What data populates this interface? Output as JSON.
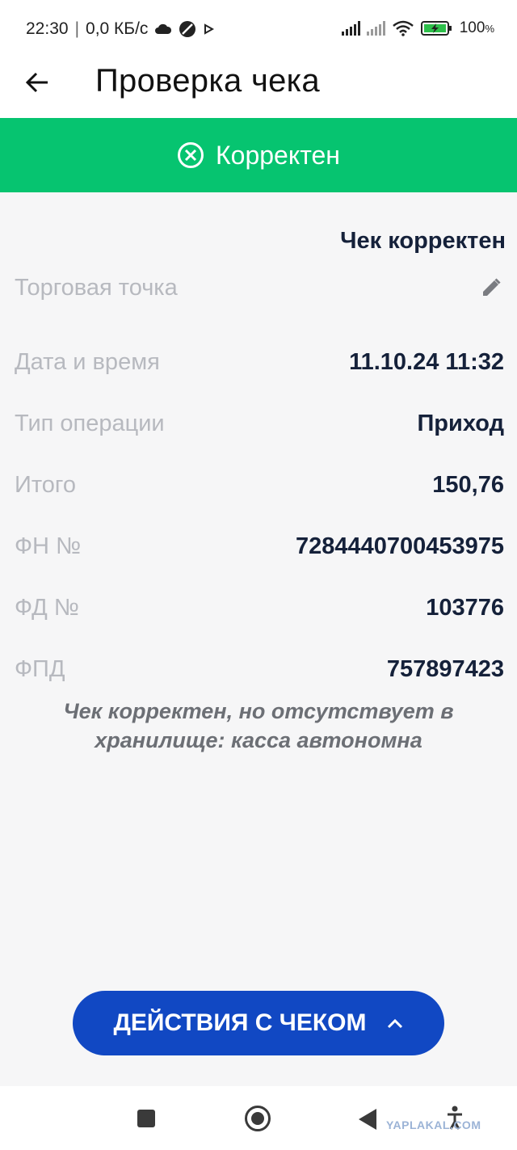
{
  "status_bar": {
    "time": "22:30",
    "separator": "|",
    "network_speed": "0,0 КБ/с",
    "battery": "100",
    "battery_unit": "%",
    "icons": [
      "cloud-icon",
      "no-disturb-icon",
      "play-icon",
      "signal-icon",
      "signal-icon",
      "wifi-icon",
      "battery-charging-icon"
    ],
    "battery_color": "#2dbf4a"
  },
  "header": {
    "title": "Проверка чека",
    "back_icon": "arrow-left-icon"
  },
  "banner": {
    "label": "Корректен",
    "icon": "circle-x-icon",
    "color": "#06c470"
  },
  "receipt": {
    "summary": "Чек корректен",
    "rows": [
      {
        "label": "Торговая точка",
        "value": ""
      },
      {
        "label": "Дата и время",
        "value": "11.10.24 11:32"
      },
      {
        "label": "Тип операции",
        "value": "Приход"
      },
      {
        "label": "Итого",
        "value": "150,76"
      },
      {
        "label": "ФН №",
        "value": "7284440700453975"
      },
      {
        "label": "ФД №",
        "value": "103776"
      },
      {
        "label": "ФПД",
        "value": "757897423"
      }
    ],
    "edit_icon": "pencil-icon",
    "note": "Чек корректен, но отсутствует в хранилище: касса автономна"
  },
  "action": {
    "label": "ДЕЙСТВИЯ С ЧЕКОМ",
    "icon": "chevron-up-icon",
    "color": "#1148c3"
  },
  "watermark": "YAPLAKAL.COM"
}
